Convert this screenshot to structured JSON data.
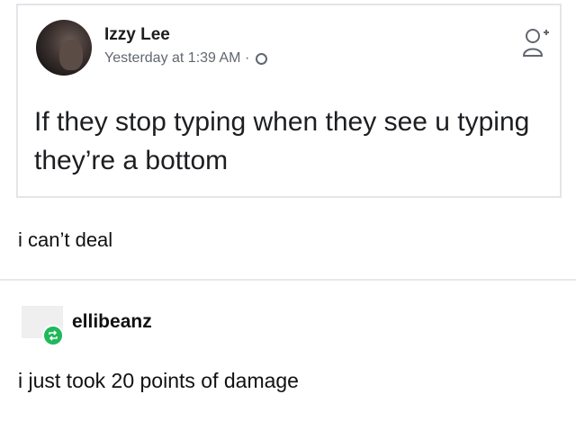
{
  "facebook_post": {
    "author": "Izzy Lee",
    "meta": "Yesterday at 1:39 AM ·",
    "text": "If they stop typing when they see u typing they’re a bottom"
  },
  "replies": [
    {
      "text": "i can’t deal"
    },
    {
      "username": "ellibeanz",
      "text": "i just took 20 points of damage"
    }
  ],
  "colors": {
    "reblog_green": "#1fb85b",
    "meta_gray": "#616770"
  },
  "icons": {
    "privacy": "globe-icon",
    "friend": "add-friend-icon",
    "reblog": "reblog-icon"
  }
}
